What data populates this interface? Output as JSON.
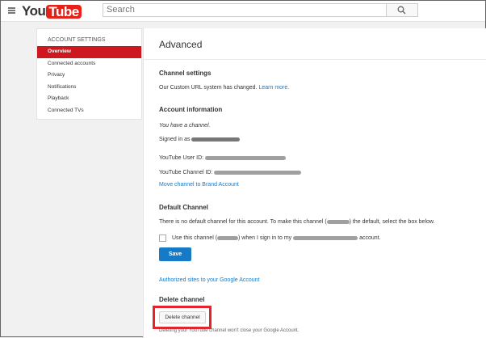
{
  "header": {
    "logo_you": "You",
    "logo_tube": "Tube",
    "search_placeholder": "Search"
  },
  "sidebar": {
    "heading": "ACCOUNT SETTINGS",
    "items": [
      {
        "label": "Overview",
        "active": true
      },
      {
        "label": "Connected accounts"
      },
      {
        "label": "Privacy"
      },
      {
        "label": "Notifications"
      },
      {
        "label": "Playback"
      },
      {
        "label": "Connected TVs"
      }
    ]
  },
  "main": {
    "title": "Advanced",
    "channel_settings": {
      "heading": "Channel settings",
      "text": "Our Custom URL system has changed.",
      "link": "Learn more."
    },
    "account_info": {
      "heading": "Account information",
      "have_channel": "You have a channel.",
      "signed_in_as": "Signed in as",
      "user_id_label": "YouTube User ID:",
      "channel_id_label": "YouTube Channel ID:",
      "move_link": "Move channel to Brand Account"
    },
    "default_channel": {
      "heading": "Default Channel",
      "text_a": "There is no default channel for this account. To make this channel (",
      "text_b": ") the default, select the box below.",
      "checkbox_a": "Use this channel (",
      "checkbox_b": ") when I sign in to my",
      "checkbox_c": "account.",
      "save_label": "Save"
    },
    "authorized_link": "Authorized sites to your Google Account",
    "delete_channel": {
      "heading": "Delete channel",
      "button_label": "Delete channel",
      "note": "Deleting your YouTube channel won't close your Google Account."
    }
  },
  "colors": {
    "accent_red": "#cc181e",
    "link_blue": "#167ac6",
    "highlight_red": "#e4232b"
  }
}
